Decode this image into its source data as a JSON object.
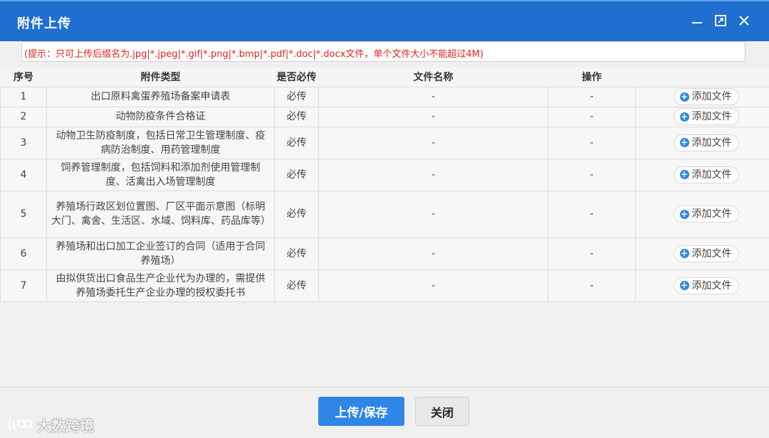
{
  "window": {
    "title": "附件上传"
  },
  "hint": "(提示：只可上传后缀名为.jpg|*.jpeg|*.gif|*.png|*.bmp|*.pdf|*.doc|*.docx文件，单个文件大小不能超过4M)",
  "table": {
    "headers": {
      "index": "序号",
      "type": "附件类型",
      "required": "是否必传",
      "filename": "文件名称",
      "action": "操作"
    },
    "rows": [
      {
        "index": "1",
        "type": "出口原料禽蛋养殖场备案申请表",
        "required": "必传",
        "filename": "-",
        "action": "-",
        "button": "添加文件"
      },
      {
        "index": "2",
        "type": "动物防疫条件合格证",
        "required": "必传",
        "filename": "-",
        "action": "-",
        "button": "添加文件"
      },
      {
        "index": "3",
        "type": "动物卫生防疫制度，包括日常卫生管理制度、疫病防治制度、用药管理制度",
        "required": "必传",
        "filename": "-",
        "action": "-",
        "button": "添加文件"
      },
      {
        "index": "4",
        "type": "饲养管理制度，包括饲料和添加剂使用管理制度、活禽出入场管理制度",
        "required": "必传",
        "filename": "-",
        "action": "-",
        "button": "添加文件"
      },
      {
        "index": "5",
        "type": "养殖场行政区划位置图、厂区平面示意图（标明大门、禽舍、生活区、水域、饲料库、药品库等）",
        "required": "必传",
        "filename": "-",
        "action": "-",
        "button": "添加文件"
      },
      {
        "index": "6",
        "type": "养殖场和出口加工企业签订的合同（适用于合同养殖场）",
        "required": "必传",
        "filename": "-",
        "action": "-",
        "button": "添加文件"
      },
      {
        "index": "7",
        "type": "由拟供货出口食品生产企业代为办理的，需提供养殖场委托生产企业办理的授权委托书",
        "required": "必传",
        "filename": "-",
        "action": "-",
        "button": "添加文件"
      }
    ]
  },
  "buttons": {
    "save": "上传/保存",
    "close": "关闭"
  },
  "watermark": "大数跨境",
  "colors": {
    "titlebar": "#1f6fd1",
    "primary": "#2f86e6",
    "hint_text": "#e0241c"
  }
}
